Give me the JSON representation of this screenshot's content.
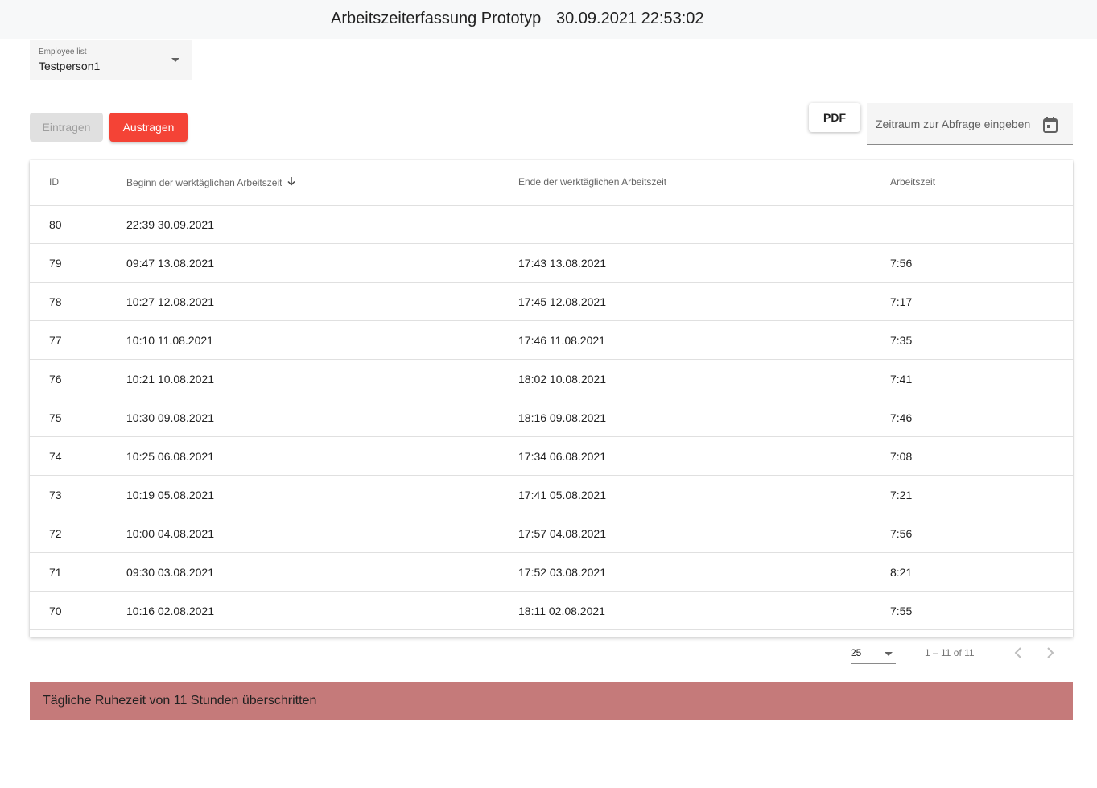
{
  "header": {
    "title": "Arbeitszeiterfassung Prototyp",
    "datetime": "30.09.2021 22:53:02"
  },
  "employee_select": {
    "label": "Employee list",
    "value": "Testperson1",
    "icon": "dropdown-arrow-icon"
  },
  "actions": {
    "eintragen_label": "Eintragen",
    "austragen_label": "Austragen",
    "pdf_label": "PDF"
  },
  "date_range": {
    "placeholder": "Zeitraum zur Abfrage eingeben",
    "icon": "calendar-icon"
  },
  "table": {
    "columns": [
      "ID",
      "Beginn der werktäglichen Arbeitszeit",
      "Ende der werktäglichen Arbeitszeit",
      "Arbeitszeit"
    ],
    "sort_icon": "arrow-down-icon",
    "rows": [
      [
        "80",
        "22:39 30.09.2021",
        "",
        ""
      ],
      [
        "79",
        "09:47 13.08.2021",
        "17:43 13.08.2021",
        "7:56"
      ],
      [
        "78",
        "10:27 12.08.2021",
        "17:45 12.08.2021",
        "7:17"
      ],
      [
        "77",
        "10:10 11.08.2021",
        "17:46 11.08.2021",
        "7:35"
      ],
      [
        "76",
        "10:21 10.08.2021",
        "18:02 10.08.2021",
        "7:41"
      ],
      [
        "75",
        "10:30 09.08.2021",
        "18:16 09.08.2021",
        "7:46"
      ],
      [
        "74",
        "10:25 06.08.2021",
        "17:34 06.08.2021",
        "7:08"
      ],
      [
        "73",
        "10:19 05.08.2021",
        "17:41 05.08.2021",
        "7:21"
      ],
      [
        "72",
        "10:00 04.08.2021",
        "17:57 04.08.2021",
        "7:56"
      ],
      [
        "71",
        "09:30 03.08.2021",
        "17:52 03.08.2021",
        "8:21"
      ],
      [
        "70",
        "10:16 02.08.2021",
        "18:11 02.08.2021",
        "7:55"
      ]
    ]
  },
  "paginator": {
    "page_size": "25",
    "range": "1 – 11 of 11"
  },
  "alert": {
    "message": "Tägliche Ruhezeit von 11 Stunden überschritten"
  },
  "colors": {
    "primary_red": "#f44336",
    "alert_bg": "#c57a7a",
    "topbar_bg": "#f7f8f9"
  }
}
